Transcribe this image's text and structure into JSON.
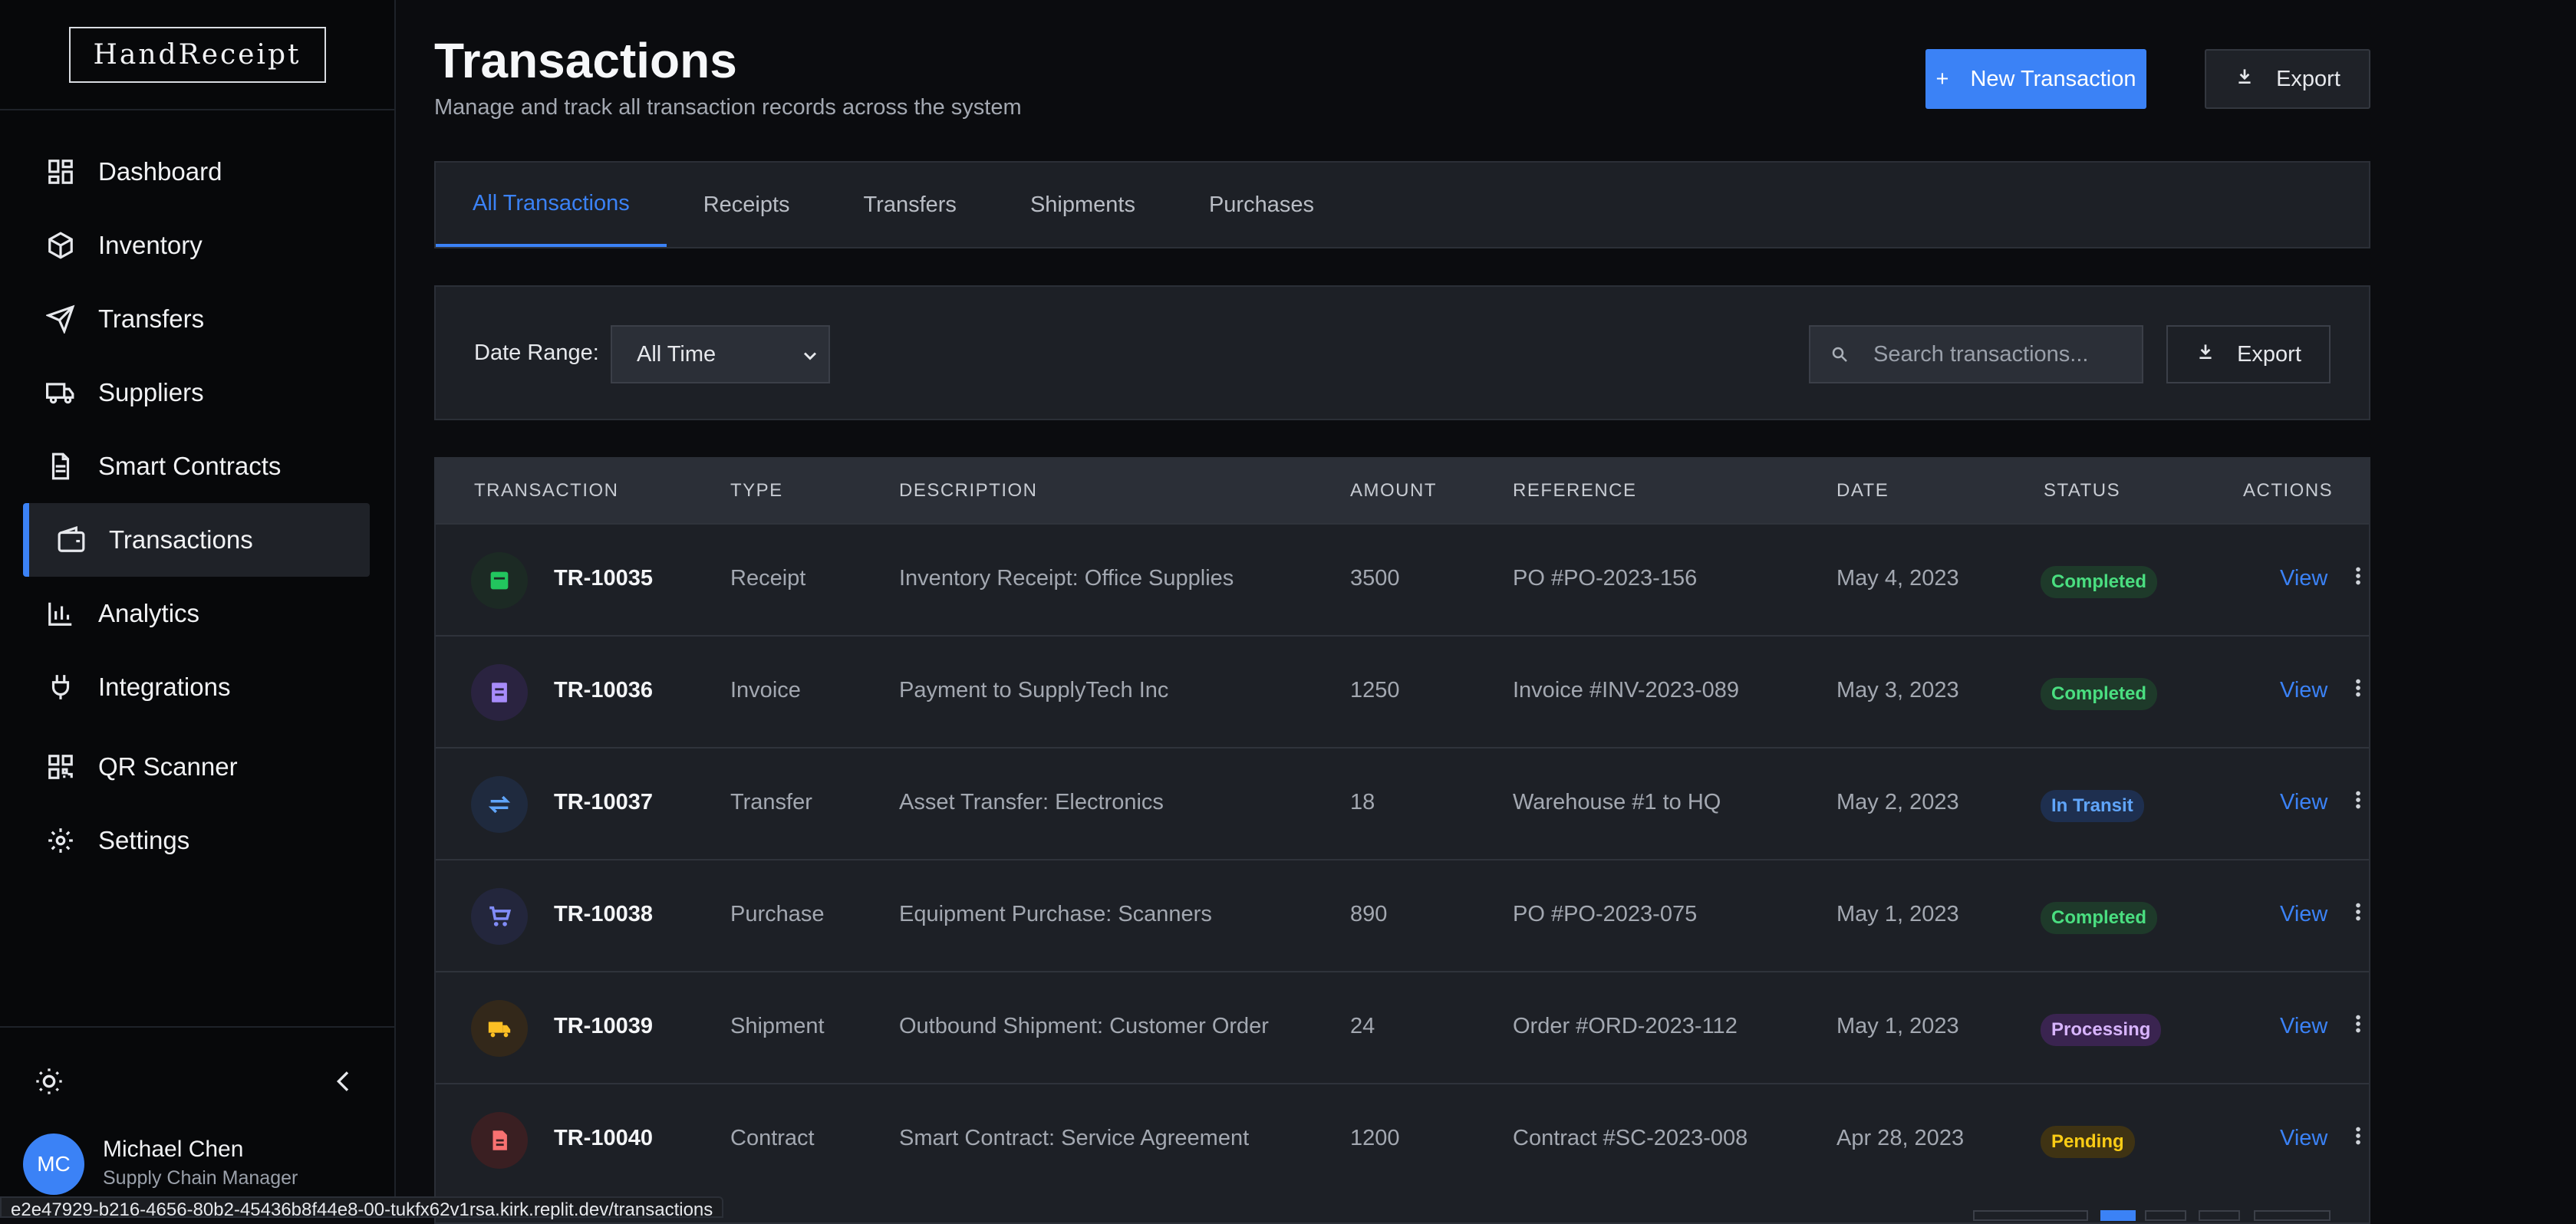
{
  "app": {
    "logo": "HandReceipt"
  },
  "sidebar": {
    "items": [
      {
        "label": "Dashboard",
        "icon": "dashboard-icon"
      },
      {
        "label": "Inventory",
        "icon": "package-icon"
      },
      {
        "label": "Transfers",
        "icon": "send-icon"
      },
      {
        "label": "Suppliers",
        "icon": "truck-icon"
      },
      {
        "label": "Smart Contracts",
        "icon": "document-icon"
      },
      {
        "label": "Transactions",
        "icon": "wallet-icon",
        "active": true
      },
      {
        "label": "Analytics",
        "icon": "bar-chart-icon"
      },
      {
        "label": "Integrations",
        "icon": "plug-icon"
      },
      {
        "label": "QR Scanner",
        "icon": "qr-code-icon"
      },
      {
        "label": "Settings",
        "icon": "gear-icon"
      }
    ],
    "user": {
      "initials": "MC",
      "name": "Michael Chen",
      "role": "Supply Chain Manager"
    }
  },
  "header": {
    "title": "Transactions",
    "subtitle": "Manage and track all transaction records across the system",
    "new_button": "New Transaction",
    "new_button_icon": "+",
    "export_button": "Export"
  },
  "tabs": [
    {
      "label": "All Transactions",
      "active": true
    },
    {
      "label": "Receipts"
    },
    {
      "label": "Transfers"
    },
    {
      "label": "Shipments"
    },
    {
      "label": "Purchases"
    }
  ],
  "filters": {
    "date_range_label": "Date Range:",
    "date_range_value": "All Time",
    "search_placeholder": "Search transactions...",
    "export_label": "Export"
  },
  "table": {
    "columns": [
      "TRANSACTION",
      "TYPE",
      "DESCRIPTION",
      "AMOUNT",
      "REFERENCE",
      "DATE",
      "STATUS",
      "ACTIONS"
    ],
    "rows": [
      {
        "id": "TR-10035",
        "type": "Receipt",
        "description": "Inventory Receipt: Office Supplies",
        "amount": "3500",
        "reference": "PO #PO-2023-156",
        "date": "May 4, 2023",
        "status": "Completed",
        "action": "View",
        "icon": "receipt-icon"
      },
      {
        "id": "TR-10036",
        "type": "Invoice",
        "description": "Payment to SupplyTech Inc",
        "amount": "1250",
        "reference": "Invoice #INV-2023-089",
        "date": "May 3, 2023",
        "status": "Completed",
        "action": "View",
        "icon": "invoice-icon"
      },
      {
        "id": "TR-10037",
        "type": "Transfer",
        "description": "Asset Transfer: Electronics",
        "amount": "18",
        "reference": "Warehouse #1 to HQ",
        "date": "May 2, 2023",
        "status": "In Transit",
        "action": "View",
        "icon": "transfer-arrows-icon"
      },
      {
        "id": "TR-10038",
        "type": "Purchase",
        "description": "Equipment Purchase: Scanners",
        "amount": "890",
        "reference": "PO #PO-2023-075",
        "date": "May 1, 2023",
        "status": "Completed",
        "action": "View",
        "icon": "cart-icon"
      },
      {
        "id": "TR-10039",
        "type": "Shipment",
        "description": "Outbound Shipment: Customer Order",
        "amount": "24",
        "reference": "Order #ORD-2023-112",
        "date": "May 1, 2023",
        "status": "Processing",
        "action": "View",
        "icon": "truck-icon"
      },
      {
        "id": "TR-10040",
        "type": "Contract",
        "description": "Smart Contract: Service Agreement",
        "amount": "1200",
        "reference": "Contract #SC-2023-008",
        "date": "Apr 28, 2023",
        "status": "Pending",
        "action": "View",
        "icon": "contract-icon"
      }
    ]
  },
  "status_bar": {
    "url": "e2e47929-b216-4656-80b2-45436b8f44e8-00-tukfx62v1rsa.kirk.replit.dev/transactions"
  },
  "colors": {
    "accent": "#3b82f6",
    "completed": "#4ade80",
    "in_transit": "#60a5fa",
    "processing": "#c084fc",
    "pending": "#facc15"
  }
}
